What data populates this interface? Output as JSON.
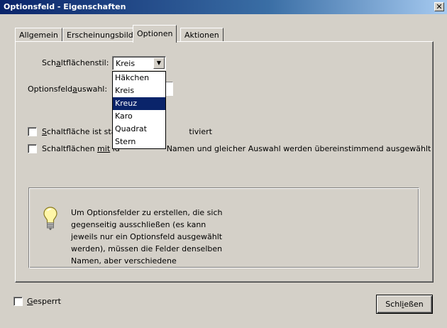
{
  "window": {
    "title": "Optionsfeld - Eigenschaften",
    "close_glyph": "✕"
  },
  "tabs": [
    {
      "label": "Allgemein",
      "active": false
    },
    {
      "label": "Erscheinungsbild",
      "active": false
    },
    {
      "label": "Optionen",
      "active": true
    },
    {
      "label": "Aktionen",
      "active": false
    }
  ],
  "button_style": {
    "label_pre": "Sch",
    "label_accel": "a",
    "label_post": "ltflächenstil:",
    "value": "Kreis",
    "arrow_glyph": "▼",
    "options": [
      "Häkchen",
      "Kreis",
      "Kreuz",
      "Karo",
      "Quadrat",
      "Stern"
    ],
    "highlighted": "Kreuz"
  },
  "option_selection": {
    "label_pre": "Optionsfeld",
    "label_accel": "a",
    "label_post": "uswahl:"
  },
  "checkbox_default": {
    "label_accel": "S",
    "label_pre": "chaltfläche ist stan",
    "label_post": "tiviert",
    "checked": false
  },
  "checkbox_unison": {
    "label_pre": "Schaltflächen ",
    "label_accel": "mit",
    "label_mid": " id",
    "label_post": "Namen und gleicher Auswahl werden übereinstimmend ausgewählt",
    "checked": false
  },
  "hint": {
    "icon": "lightbulb-icon",
    "lines": [
      "Um Optionsfelder zu erstellen, die sich",
      "gegenseitig ausschließen (es kann",
      "jeweils nur ein Optionsfeld ausgewählt",
      "werden), müssen die Felder denselben",
      "Namen, aber verschiedene"
    ]
  },
  "locked": {
    "label_accel": "G",
    "label_post": "esperrt",
    "checked": false
  },
  "close_button": {
    "label_pre": "Schl",
    "label_accel": "i",
    "label_post": "eßen"
  },
  "colors": {
    "face": "#d4d0c8",
    "titlebar": "#0a246a",
    "selection": "#0a246a"
  }
}
